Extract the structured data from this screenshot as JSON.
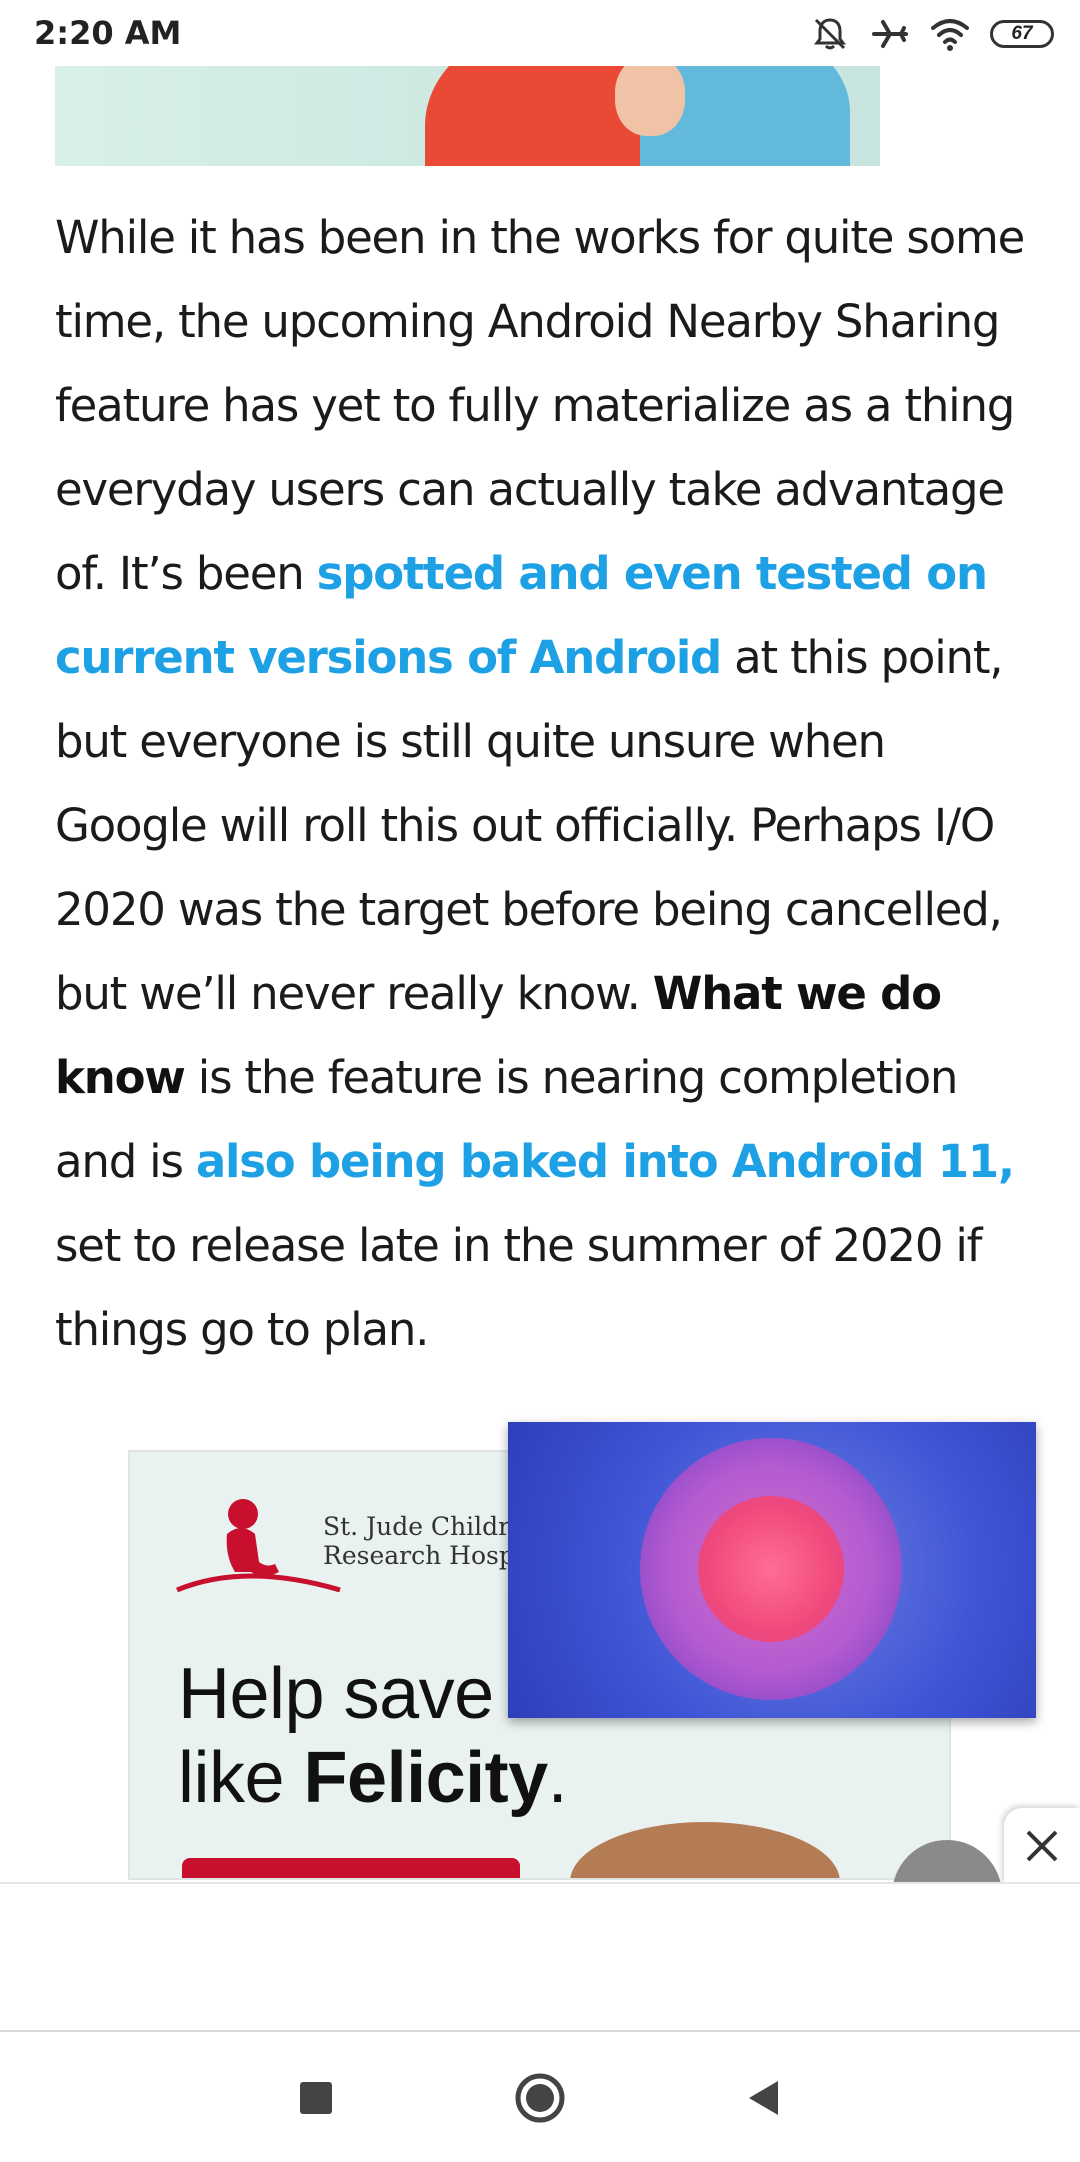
{
  "status_bar": {
    "time": "2:20 AM",
    "battery": "67",
    "icons": [
      "bell-off-icon",
      "airplane-icon",
      "wifi-icon",
      "battery-icon"
    ]
  },
  "article": {
    "seg1": "While it has been in the works for quite some time, the upcoming Android Nearby Sharing feature has yet to fully materialize as a thing everyday users can actually take advantage of. It’s been ",
    "link1": "spotted and even tested on current versions of Android",
    "seg2": " at this point, but everyone is still quite unsure when Google will roll this out officially. Perhaps I/O 2020 was the target before being cancelled, but we’ll never really know. ",
    "bold1": "What we do know",
    "seg3": " is the feature is nearing completion and is ",
    "link2": "also being baked into Android 11,",
    "seg4": " set to release late in the summer of 2020 if things go to plan."
  },
  "ad": {
    "org_line1": "St. Jude Childre",
    "org_line2": "Research Hospi",
    "headline_line1": "Help save",
    "headline_pre": "like ",
    "headline_bold": "Felicity",
    "headline_post": "."
  },
  "colors": {
    "link": "#1da1e4",
    "ad_red": "#c8102e"
  },
  "navigation": {
    "icons": [
      "recents-square-icon",
      "home-circle-icon",
      "back-triangle-icon"
    ]
  }
}
